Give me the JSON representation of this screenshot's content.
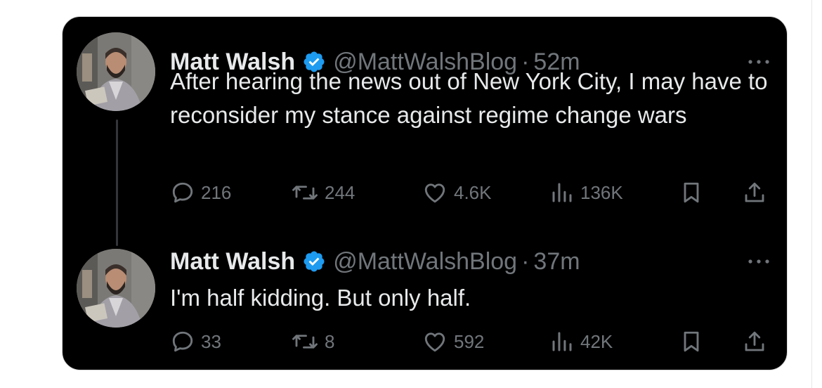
{
  "colors": {
    "card_bg": "#000000",
    "primary_text": "#e7e9ea",
    "secondary_text": "#71767b",
    "verified_badge": "#1d9bf0"
  },
  "tweets": [
    {
      "name": "Matt Walsh",
      "handle": "@MattWalshBlog",
      "separator": "·",
      "time": "52m",
      "text": "After hearing the news out of New York City, I may have to reconsider my stance against regime change wars",
      "replies": "216",
      "reposts": "244",
      "likes": "4.6K",
      "views": "136K"
    },
    {
      "name": "Matt Walsh",
      "handle": "@MattWalshBlog",
      "separator": "·",
      "time": "37m",
      "text": "I'm half kidding. But only half.",
      "replies": "33",
      "reposts": "8",
      "likes": "592",
      "views": "42K"
    }
  ],
  "icons": {
    "verified": "verified-badge-icon",
    "more": "more-dots-icon",
    "reply": "reply-icon",
    "repost": "repost-icon",
    "like": "heart-icon",
    "views": "views-chart-icon",
    "bookmark": "bookmark-icon",
    "share": "share-icon"
  }
}
